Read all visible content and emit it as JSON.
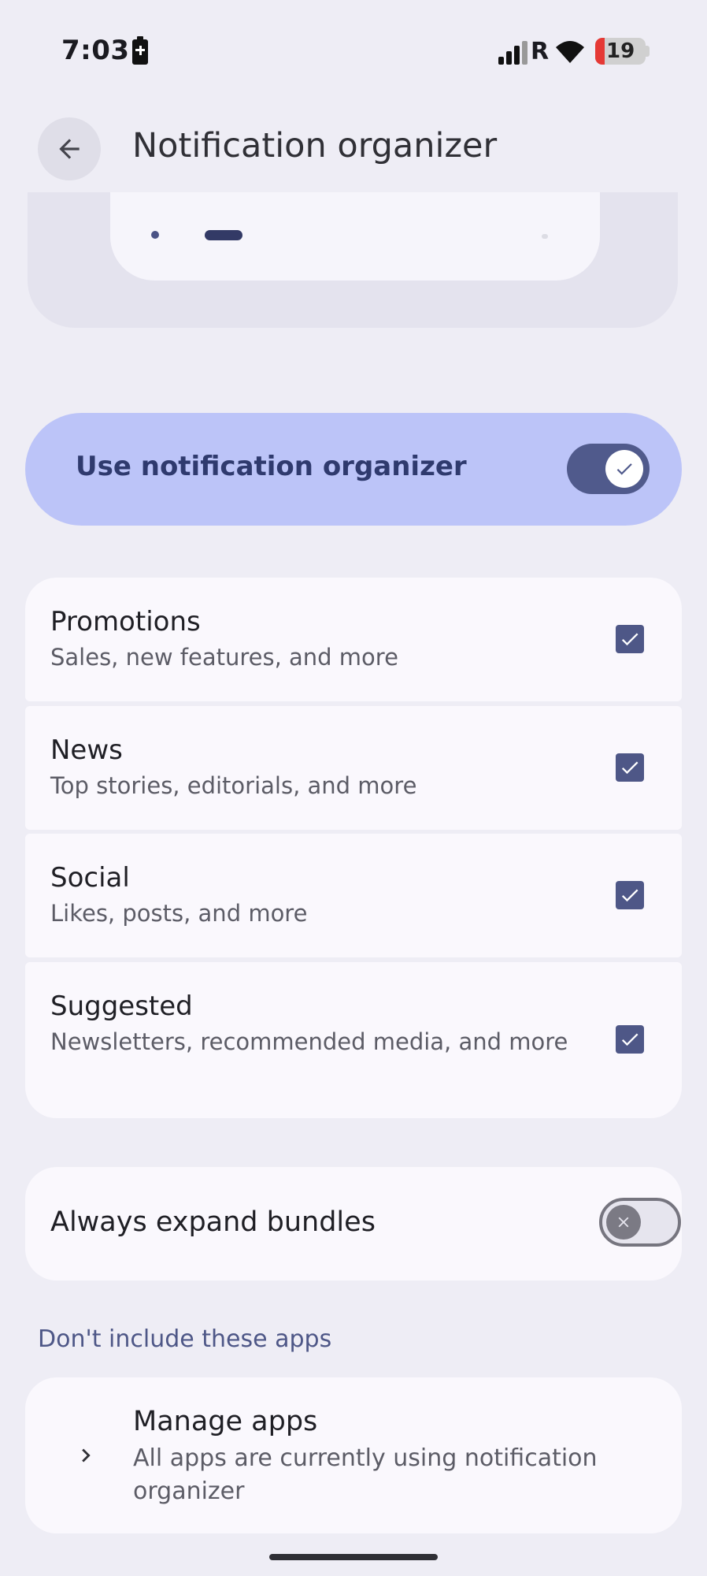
{
  "status_bar": {
    "time": "7:03",
    "network": "R",
    "battery_percent": "19"
  },
  "app_bar": {
    "title": "Notification organizer",
    "back_icon": "arrow-back-icon"
  },
  "main_toggle": {
    "label": "Use notification organizer",
    "enabled": true
  },
  "categories": [
    {
      "title": "Promotions",
      "subtitle": "Sales, new features, and more",
      "checked": true
    },
    {
      "title": "News",
      "subtitle": "Top stories, editorials, and more",
      "checked": true
    },
    {
      "title": "Social",
      "subtitle": "Likes, posts, and more",
      "checked": true
    },
    {
      "title": "Suggested",
      "subtitle": "Newsletters, recommended media, and more",
      "checked": true
    }
  ],
  "expand_bundles": {
    "label": "Always expand bundles",
    "enabled": false
  },
  "exclusions": {
    "header": "Don't include these apps",
    "manage_title": "Manage apps",
    "manage_subtitle": "All apps are currently using notification organizer"
  },
  "colors": {
    "background": "#eeedf5",
    "accent": "#4e5787",
    "toggle_card": "#bcc4f8",
    "card": "#faf8fd"
  }
}
